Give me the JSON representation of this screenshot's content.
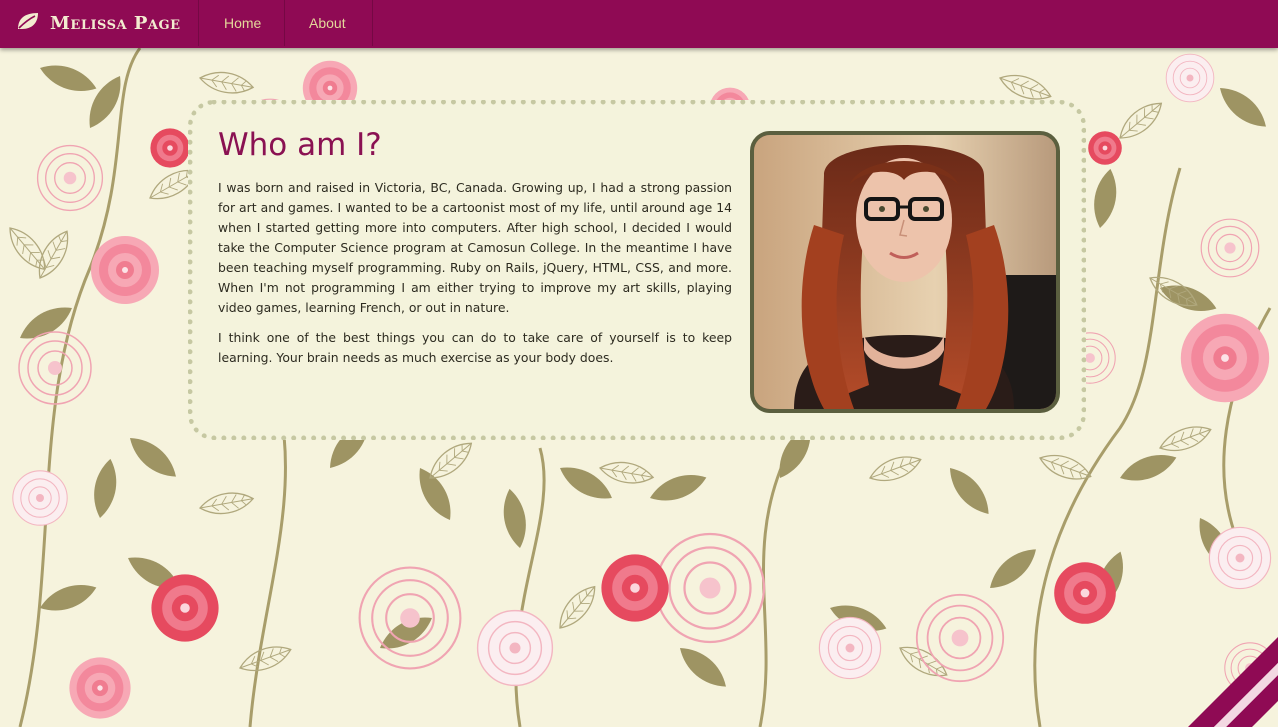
{
  "navbar": {
    "brand_name": "Melissa Page",
    "brand_icon": "leaf-icon",
    "links": [
      {
        "label": "Home"
      },
      {
        "label": "About"
      }
    ]
  },
  "about": {
    "title": "Who am I?",
    "paragraphs": [
      "I was born and raised in Victoria, BC, Canada. Growing up, I had a strong passion for art and games. I wanted to be a cartoonist most of my life, until around age 14 when I started getting more into computers. After high school, I decided I would take the Computer Science program at Camosun College. In the meantime I have been teaching myself programming. Ruby on Rails, jQuery, HTML, CSS, and more. When I'm not programming I am either trying to improve my art skills, playing video games, learning French, or out in nature.",
      "I think one of the best things you can do to take care of yourself is to keep learning. Your brain needs as much exercise as your body does."
    ]
  },
  "colors": {
    "navbar": "#8f0a54",
    "brand_text": "#f3ecd0",
    "nav_link": "#e4d79a",
    "title": "#8a1152",
    "card_bg": "#f4f3dc",
    "card_border": "#c6c8a2",
    "photo_border": "#5b5f3f",
    "page_bg": "#f6f3dd",
    "flower_pink": "#f07c90",
    "flower_red": "#e64a5f",
    "leaf_olive": "#9e9463"
  }
}
